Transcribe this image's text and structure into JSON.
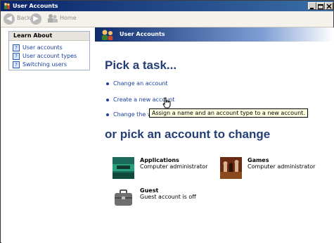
{
  "window": {
    "title": "User Accounts"
  },
  "toolbar": {
    "back_label": "Back",
    "home_label": "Home"
  },
  "learn_about": {
    "heading": "Learn About",
    "items": [
      "User accounts",
      "User account types",
      "Switching users"
    ]
  },
  "banner": {
    "title": "User Accounts"
  },
  "tasks": {
    "heading": "Pick a task...",
    "items": [
      "Change an account",
      "Create a new account",
      "Change the way users log on or off"
    ]
  },
  "tooltip": {
    "text": "Assign a name and an account type to a new account."
  },
  "accounts": {
    "heading": "or pick an account to change",
    "list": [
      {
        "name": "Applications",
        "type": "Computer administrator"
      },
      {
        "name": "Games",
        "type": "Computer administrator"
      },
      {
        "name": "Guest",
        "type": "Guest account is off"
      }
    ]
  },
  "colors": {
    "link": "#1a3fa1",
    "heading": "#243f77",
    "titlebar": "#0a246a",
    "tooltip_bg": "#ffffe1"
  }
}
